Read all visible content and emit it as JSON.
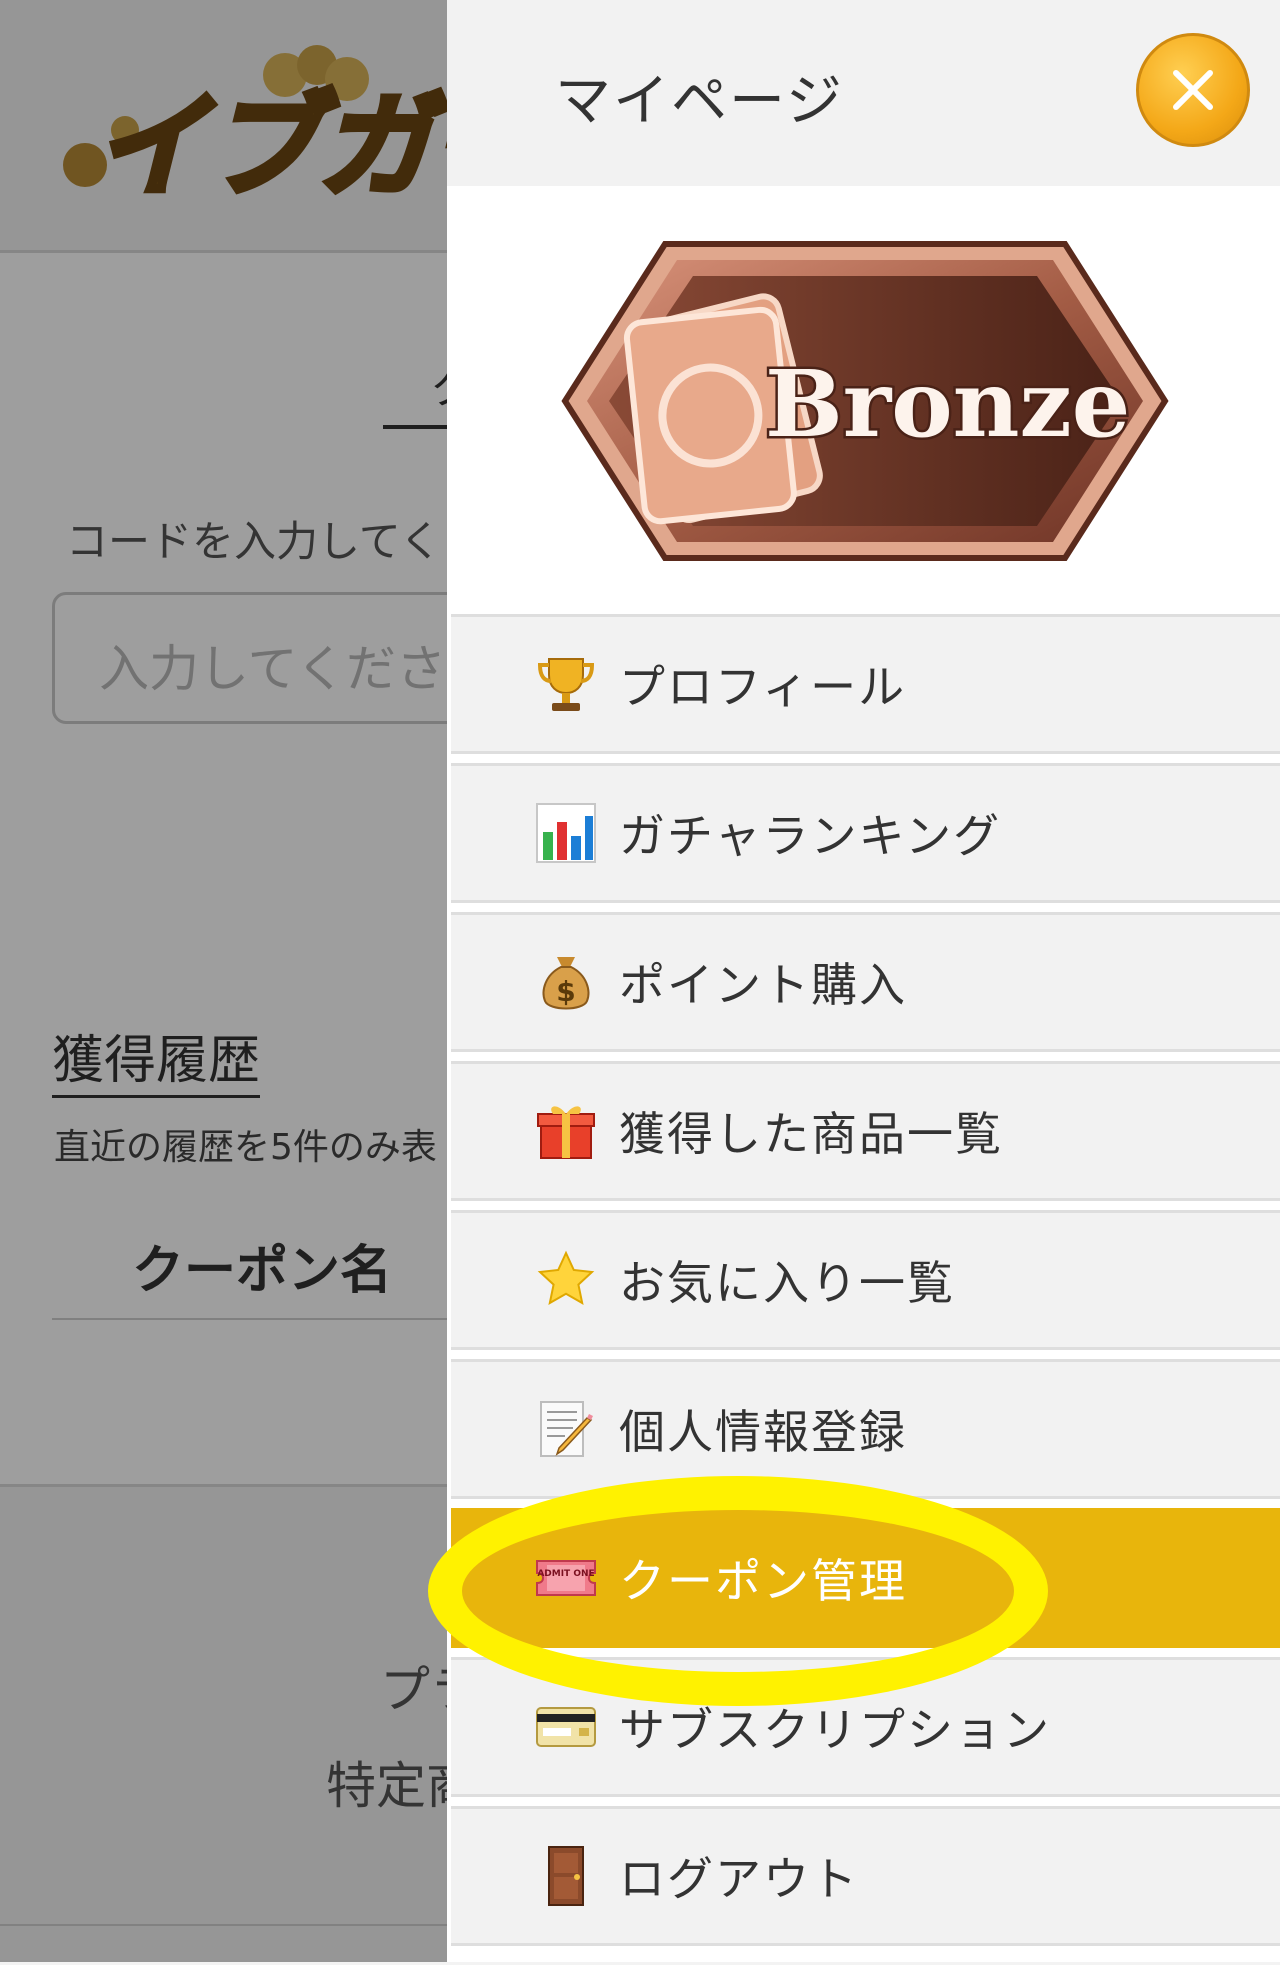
{
  "background": {
    "logo_text": "イブガチャ",
    "tab_partial": "ク",
    "code_label": "コードを入力してく",
    "input_placeholder": "入力してくださ",
    "history_title": "獲得履歴",
    "history_subtitle": "直近の履歴を5件のみ表",
    "coupon_column": "クーポン名",
    "footer_line1": "プラ",
    "footer_line2": "特定商"
  },
  "drawer": {
    "title": "マイページ",
    "close_icon": "close-icon",
    "rank_badge": {
      "label": "Bronze",
      "color": "#b8705a"
    },
    "items": [
      {
        "icon": "trophy-icon",
        "label": "プロフィール",
        "active": false
      },
      {
        "icon": "bar-chart-icon",
        "label": "ガチャランキング",
        "active": false
      },
      {
        "icon": "money-bag-icon",
        "label": "ポイント購入",
        "active": false
      },
      {
        "icon": "gift-icon",
        "label": "獲得した商品一覧",
        "active": false
      },
      {
        "icon": "star-icon",
        "label": "お気に入り一覧",
        "active": false
      },
      {
        "icon": "memo-icon",
        "label": "個人情報登録",
        "active": false
      },
      {
        "icon": "ticket-icon",
        "label": "クーポン管理",
        "active": true
      },
      {
        "icon": "credit-card-icon",
        "label": "サブスクリプション",
        "active": false
      },
      {
        "icon": "door-icon",
        "label": "ログアウト",
        "active": false
      }
    ],
    "ticket_icon_text": "ADMIT ONE"
  },
  "colors": {
    "accent": "#e8b50c",
    "close_button": "#f4a818",
    "highlight_annotation": "#fff200"
  }
}
